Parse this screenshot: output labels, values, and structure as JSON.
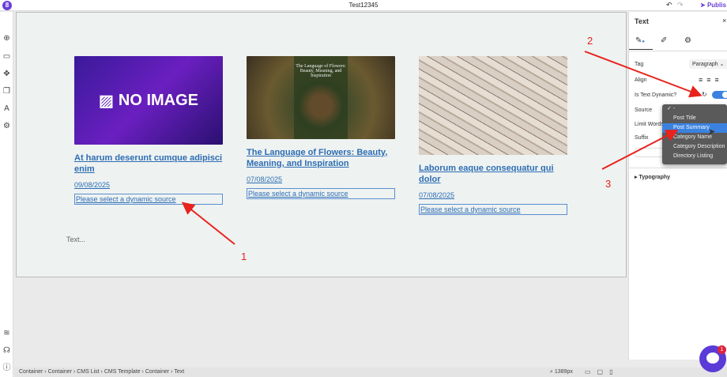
{
  "app": {
    "logo": "8",
    "title": "Test12345",
    "publish": "Publis"
  },
  "cards": [
    {
      "image_text": "NO IMAGE",
      "title": "At harum deserunt cumque adipisci enim",
      "date": "09/08/2025",
      "dynamic": "Please select a dynamic source"
    },
    {
      "image_text": "The Language of Flowers: Beauty, Meaning, and Inspiration",
      "title": "The Language of Flowers: Beauty, Meaning, and Inspiration",
      "date": "07/08/2025",
      "dynamic": "Please select a dynamic source"
    },
    {
      "image_text": "",
      "title": "Laborum eaque consequatur qui dolor",
      "date": "07/08/2025",
      "dynamic": "Please select a dynamic source"
    }
  ],
  "canvas_text": "Text...",
  "panel": {
    "title": "Text",
    "tag_label": "Tag",
    "tag_value": "Paragraph",
    "align_label": "Align",
    "dynamic_label": "Is Text Dynamic?",
    "dynamic_on": true,
    "source_label": "Source",
    "limit_label": "Limit Words",
    "suffix_label": "Suffix",
    "typography": "Typography"
  },
  "dropdown": {
    "options": [
      "-",
      "Post Title",
      "Post Summary",
      "Category Name",
      "Category Description",
      "Directory Listing"
    ],
    "selected": "Post Summary",
    "checked": "-"
  },
  "breadcrumb": [
    "Container",
    "Container",
    "CMS List",
    "CMS Template",
    "Container",
    "Text"
  ],
  "zoom": "1389px",
  "annotations": [
    "1",
    "2",
    "3"
  ],
  "chat_badge": "1"
}
